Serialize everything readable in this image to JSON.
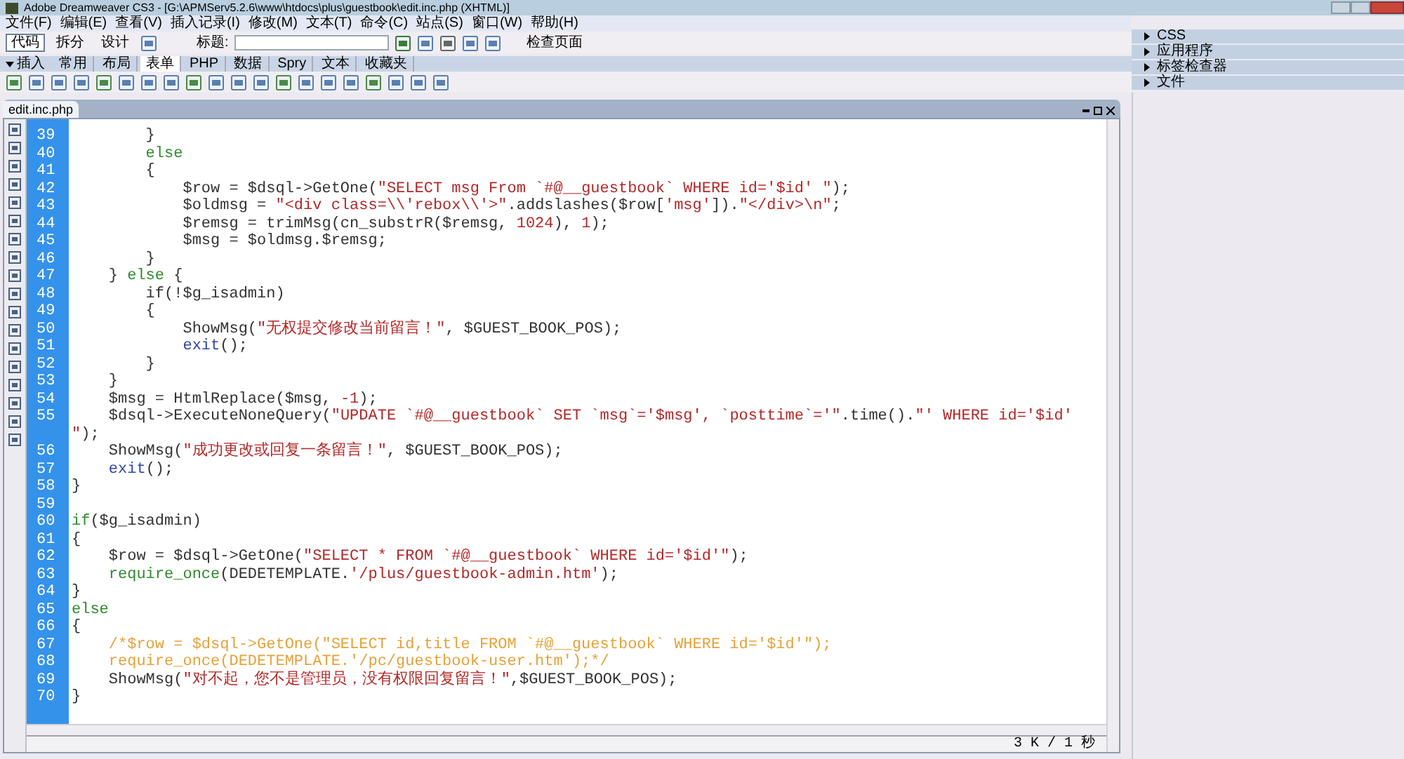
{
  "window": {
    "title": "Adobe Dreamweaver CS3 - [G:\\APMServ5.2.6\\www\\htdocs\\plus\\guestbook\\edit.inc.php (XHTML)]"
  },
  "menu": [
    "文件(F)",
    "编辑(E)",
    "查看(V)",
    "插入记录(I)",
    "修改(M)",
    "文本(T)",
    "命令(C)",
    "站点(S)",
    "窗口(W)",
    "帮助(H)"
  ],
  "view_buttons": [
    {
      "label": "代码",
      "selected": true
    },
    {
      "label": "拆分",
      "selected": false
    },
    {
      "label": "设计",
      "selected": false
    }
  ],
  "title_field": {
    "label": "标题:"
  },
  "check_page_button": "检查页面",
  "insert_bar": {
    "label": "插入",
    "expanded": true,
    "tabs": [
      {
        "label": "常用",
        "selected": false
      },
      {
        "label": "布局",
        "selected": false
      },
      {
        "label": "表单",
        "selected": true
      },
      {
        "label": "PHP",
        "selected": false
      },
      {
        "label": "数据",
        "selected": false
      },
      {
        "label": "Spry",
        "selected": false
      },
      {
        "label": "文本",
        "selected": false
      },
      {
        "label": "收藏夹",
        "selected": false
      }
    ]
  },
  "document_tab": "edit.inc.php",
  "code_lines": [
    {
      "number": "39",
      "tokens": [
        {
          "kind": "plain",
          "text": "        }"
        }
      ]
    },
    {
      "number": "40",
      "tokens": [
        {
          "kind": "keyword",
          "text": "        else"
        }
      ]
    },
    {
      "number": "41",
      "tokens": [
        {
          "kind": "plain",
          "text": "        {"
        }
      ]
    },
    {
      "number": "42",
      "tokens": [
        {
          "kind": "plain",
          "text": "            $row = $dsql->GetOne("
        },
        {
          "kind": "string",
          "text": "\"SELECT msg From `#@__guestbook` WHERE id='$id' \""
        },
        {
          "kind": "plain",
          "text": ");"
        }
      ]
    },
    {
      "number": "43",
      "tokens": [
        {
          "kind": "plain",
          "text": "            $oldmsg = "
        },
        {
          "kind": "string",
          "text": "\"<div class=\\\\'rebox\\\\'>\""
        },
        {
          "kind": "plain",
          "text": ".addslashes($row["
        },
        {
          "kind": "string",
          "text": "'msg'"
        },
        {
          "kind": "plain",
          "text": "])."
        },
        {
          "kind": "string",
          "text": "\"</div>\\n\""
        },
        {
          "kind": "plain",
          "text": ";"
        }
      ]
    },
    {
      "number": "44",
      "tokens": [
        {
          "kind": "plain",
          "text": "            $remsg = trimMsg(cn_substrR($remsg, "
        },
        {
          "kind": "string",
          "text": "1024"
        },
        {
          "kind": "plain",
          "text": "), "
        },
        {
          "kind": "string",
          "text": "1"
        },
        {
          "kind": "plain",
          "text": ");"
        }
      ]
    },
    {
      "number": "45",
      "tokens": [
        {
          "kind": "plain",
          "text": "            $msg = $oldmsg.$remsg;"
        }
      ]
    },
    {
      "number": "46",
      "tokens": [
        {
          "kind": "plain",
          "text": "        }"
        }
      ]
    },
    {
      "number": "47",
      "tokens": [
        {
          "kind": "plain",
          "text": "    } "
        },
        {
          "kind": "keyword",
          "text": "else"
        },
        {
          "kind": "plain",
          "text": " {"
        }
      ]
    },
    {
      "number": "48",
      "tokens": [
        {
          "kind": "plain",
          "text": "        if(!$g_isadmin)"
        }
      ]
    },
    {
      "number": "49",
      "tokens": [
        {
          "kind": "plain",
          "text": "        {"
        }
      ]
    },
    {
      "number": "50",
      "tokens": [
        {
          "kind": "plain",
          "text": "            ShowMsg("
        },
        {
          "kind": "string",
          "text": "\"无权提交修改当前留言！\""
        },
        {
          "kind": "plain",
          "text": ", $GUEST_BOOK_POS);"
        }
      ]
    },
    {
      "number": "51",
      "tokens": [
        {
          "kind": "function",
          "text": "            exit"
        },
        {
          "kind": "plain",
          "text": "();"
        }
      ]
    },
    {
      "number": "52",
      "tokens": [
        {
          "kind": "plain",
          "text": "        }"
        }
      ]
    },
    {
      "number": "53",
      "tokens": [
        {
          "kind": "plain",
          "text": "    }"
        }
      ]
    },
    {
      "number": "54",
      "tokens": [
        {
          "kind": "plain",
          "text": "    $msg = HtmlReplace($msg, "
        },
        {
          "kind": "string",
          "text": "-1"
        },
        {
          "kind": "plain",
          "text": ");"
        }
      ]
    },
    {
      "number": "55",
      "tokens": [
        {
          "kind": "plain",
          "text": "    $dsql->ExecuteNoneQuery("
        },
        {
          "kind": "string",
          "text": "\"UPDATE `#@__guestbook` SET `msg`='$msg', `posttime`='\""
        },
        {
          "kind": "plain",
          "text": ".time()."
        },
        {
          "kind": "string",
          "text": "\"' WHERE id='$id'"
        }
      ],
      "wrap": [
        {
          "kind": "string",
          "text": "\""
        },
        {
          "kind": "plain",
          "text": ");"
        }
      ]
    },
    {
      "number": "56",
      "tokens": [
        {
          "kind": "plain",
          "text": "    ShowMsg("
        },
        {
          "kind": "string",
          "text": "\"成功更改或回复一条留言！\""
        },
        {
          "kind": "plain",
          "text": ", $GUEST_BOOK_POS);"
        }
      ]
    },
    {
      "number": "57",
      "tokens": [
        {
          "kind": "function",
          "text": "    exit"
        },
        {
          "kind": "plain",
          "text": "();"
        }
      ]
    },
    {
      "number": "58",
      "tokens": [
        {
          "kind": "plain",
          "text": "}"
        }
      ]
    },
    {
      "number": "59"
    },
    {
      "number": "60",
      "tokens": [
        {
          "kind": "keyword",
          "text": "if"
        },
        {
          "kind": "plain",
          "text": "($g_isadmin)"
        }
      ]
    },
    {
      "number": "61",
      "tokens": [
        {
          "kind": "plain",
          "text": "{"
        }
      ]
    },
    {
      "number": "62",
      "tokens": [
        {
          "kind": "plain",
          "text": "    $row = $dsql->GetOne("
        },
        {
          "kind": "string",
          "text": "\"SELECT * FROM `#@__guestbook` WHERE id='$id'\""
        },
        {
          "kind": "plain",
          "text": ");"
        }
      ]
    },
    {
      "number": "63",
      "tokens": [
        {
          "kind": "keyword",
          "text": "    require_once"
        },
        {
          "kind": "plain",
          "text": "(DEDETEMPLATE."
        },
        {
          "kind": "string",
          "text": "'/plus/guestbook-admin.htm'"
        },
        {
          "kind": "plain",
          "text": ");"
        }
      ]
    },
    {
      "number": "64",
      "tokens": [
        {
          "kind": "plain",
          "text": "}"
        }
      ]
    },
    {
      "number": "65",
      "tokens": [
        {
          "kind": "keyword",
          "text": "else"
        }
      ]
    },
    {
      "number": "66",
      "tokens": [
        {
          "kind": "plain",
          "text": "{"
        }
      ]
    },
    {
      "number": "67",
      "tokens": [
        {
          "kind": "comment",
          "text": "    /*$row = $dsql->GetOne(\"SELECT id,title FROM `#@__guestbook` WHERE id='$id'\");"
        }
      ]
    },
    {
      "number": "68",
      "tokens": [
        {
          "kind": "comment",
          "text": "    require_once(DEDETEMPLATE.'/pc/guestbook-user.htm');*/"
        }
      ]
    },
    {
      "number": "69",
      "tokens": [
        {
          "kind": "plain",
          "text": "    ShowMsg("
        },
        {
          "kind": "string",
          "text": "\"对不起，您不是管理员，没有权限回复留言！\""
        },
        {
          "kind": "plain",
          "text": ",$GUEST_BOOK_POS);"
        }
      ]
    },
    {
      "number": "70",
      "tokens": [
        {
          "kind": "plain",
          "text": "}"
        }
      ]
    }
  ],
  "status_bar": {
    "size": "3 K / 1 秒"
  },
  "panels": [
    {
      "label": "CSS",
      "expanded": false
    },
    {
      "label": "应用程序",
      "expanded": false
    },
    {
      "label": "标签检查器",
      "expanded": false
    },
    {
      "label": "文件",
      "expanded": false
    }
  ]
}
